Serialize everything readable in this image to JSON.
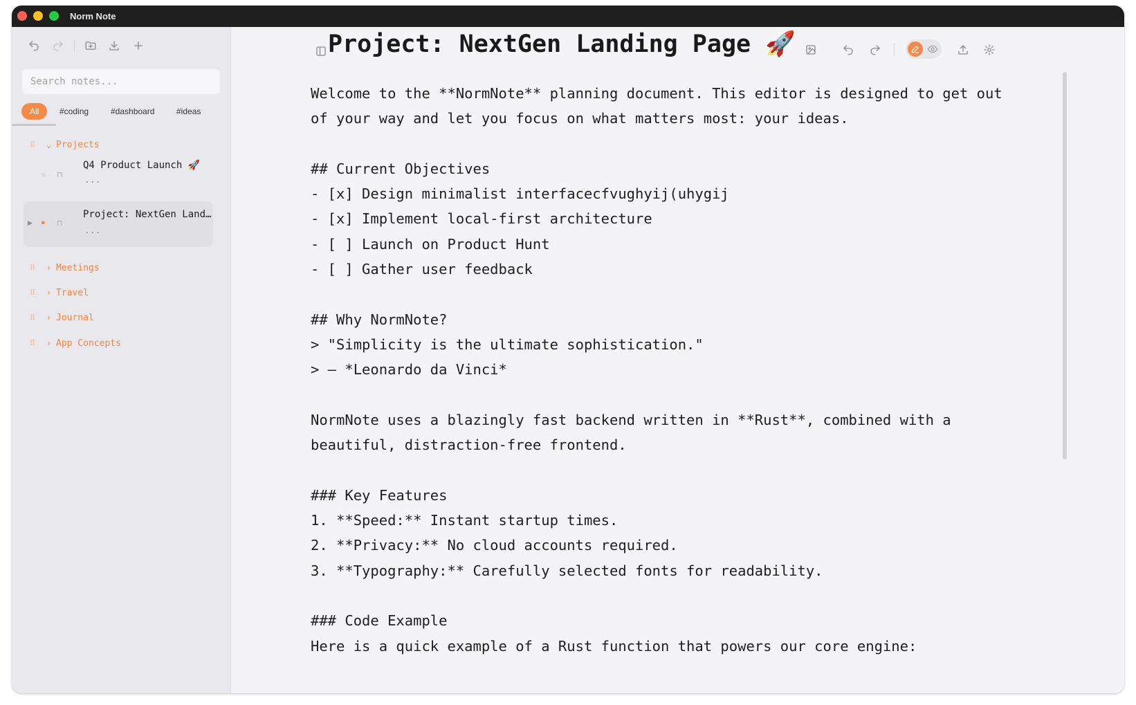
{
  "window": {
    "title": "Norm Note"
  },
  "sidebar": {
    "search_placeholder": "Search notes...",
    "tags": [
      "All",
      "#coding",
      "#dashboard",
      "#ideas"
    ],
    "folders": {
      "projects": "Projects",
      "meetings": "Meetings",
      "travel": "Travel",
      "journal": "Journal",
      "app_concepts": "App Concepts"
    },
    "notes": [
      {
        "title": "Q4 Product Launch 🚀",
        "preview": "..."
      },
      {
        "title": "Project: NextGen Land…",
        "preview": "..."
      }
    ]
  },
  "document": {
    "title": "Project: NextGen Landing Page 🚀",
    "body": "Welcome to the **NormNote** planning document. This editor is designed to get out of your way and let you focus on what matters most: your ideas.\n\n## Current Objectives\n- [x] Design minimalist interfacecfvughyij(uhygij\n- [x] Implement local-first architecture\n- [ ] Launch on Product Hunt\n- [ ] Gather user feedback\n\n## Why NormNote?\n> \"Simplicity is the ultimate sophistication.\"\n> — *Leonardo da Vinci*\n\nNormNote uses a blazingly fast backend written in **Rust**, combined with a beautiful, distraction-free frontend.\n\n### Key Features\n1. **Speed:** Instant startup times.\n2. **Privacy:** No cloud accounts required.\n3. **Typography:** Carefully selected fonts for readability.\n\n### Code Example\nHere is a quick example of a Rust function that powers our core engine:"
  },
  "colors": {
    "accent": "#f28a4c",
    "titlebar": "#1f1f1f",
    "sidebar": "#e9e9ed",
    "editor_bg": "#f4f4f6"
  }
}
